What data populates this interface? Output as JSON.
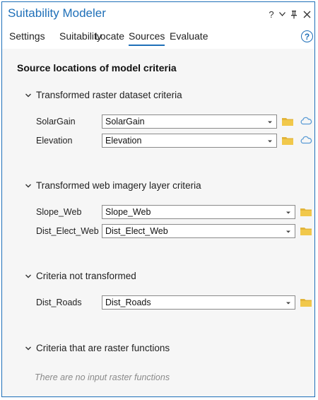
{
  "window": {
    "title": "Suitability Modeler",
    "controls": {
      "help": "?",
      "options": "▾",
      "pin": "📌",
      "close": "✕"
    }
  },
  "tabs": [
    {
      "label": "Settings",
      "active": false
    },
    {
      "label": "Suitability",
      "active": false
    },
    {
      "label": "Locate",
      "active": false
    },
    {
      "label": "Sources",
      "active": true
    },
    {
      "label": "Evaluate",
      "active": false
    }
  ],
  "help_icon": "?",
  "main": {
    "heading": "Source locations of model criteria",
    "sections": [
      {
        "title": "Transformed raster dataset criteria",
        "rows": [
          {
            "label": "SolarGain",
            "value": "SolarGain",
            "has_cloud": true
          },
          {
            "label": "Elevation",
            "value": "Elevation",
            "has_cloud": true
          }
        ]
      },
      {
        "title": "Transformed web imagery layer criteria",
        "rows": [
          {
            "label": "Slope_Web",
            "value": "Slope_Web",
            "has_cloud": false
          },
          {
            "label": "Dist_Elect_Web",
            "value": "Dist_Elect_Web",
            "has_cloud": false
          }
        ]
      },
      {
        "title": "Criteria not transformed",
        "rows": [
          {
            "label": "Dist_Roads",
            "value": "Dist_Roads",
            "has_cloud": false
          }
        ]
      },
      {
        "title": "Criteria that are raster functions",
        "empty_message": "There are no input raster functions"
      }
    ]
  },
  "colors": {
    "accent": "#1e6fb8",
    "folder": "#e3b53a",
    "cloud": "#5a9bd5",
    "content_bg": "#f6f6f6"
  }
}
